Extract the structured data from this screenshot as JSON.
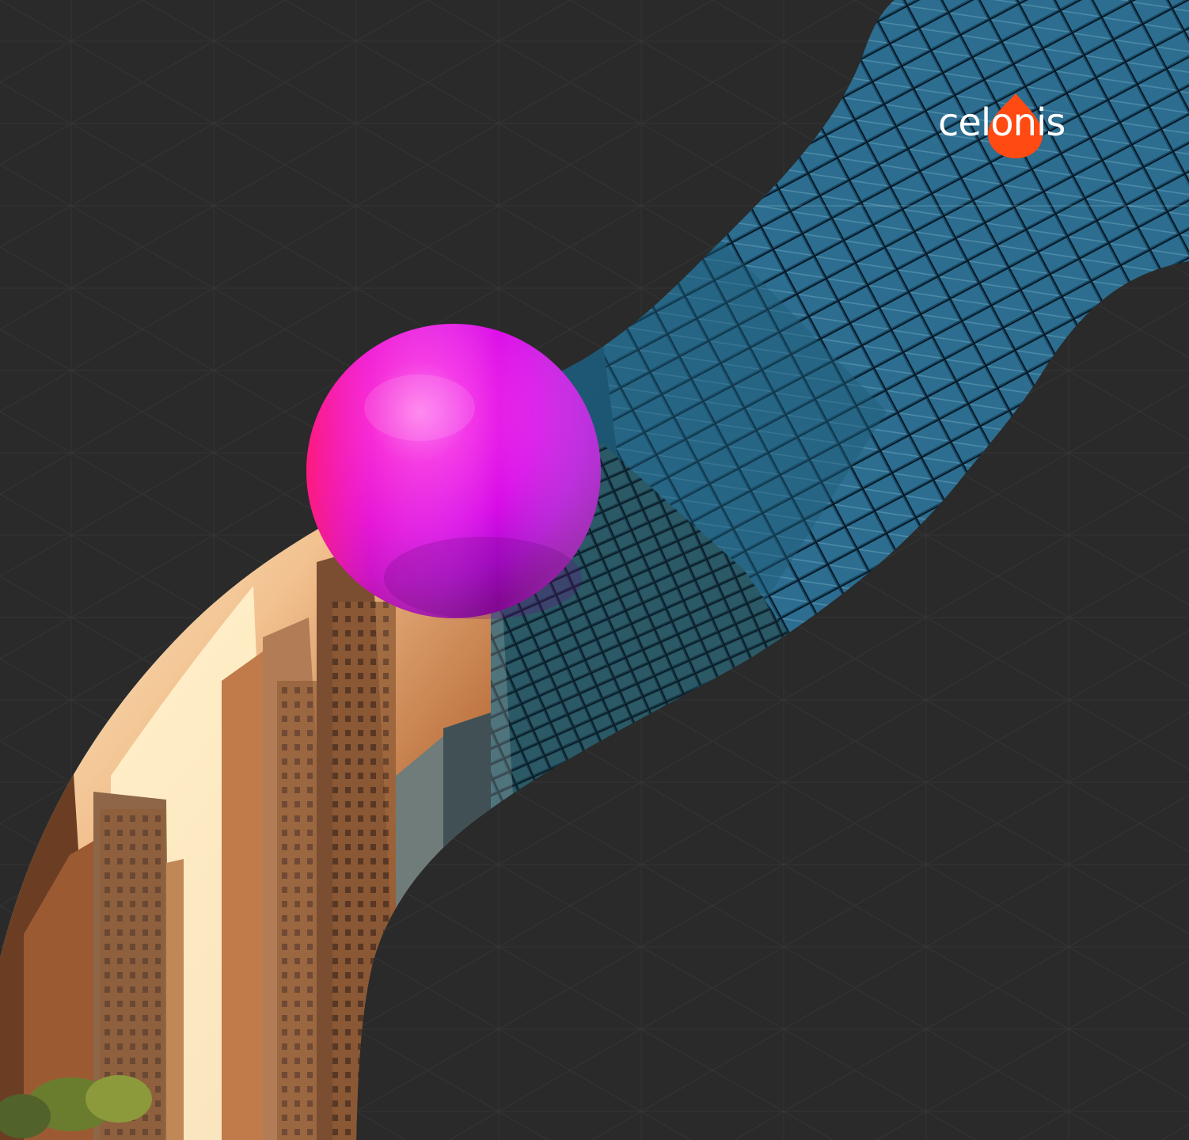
{
  "brand": {
    "wordmark": "celonis",
    "wordmark_color": "#ffffff",
    "mark_color": "#ff4a12"
  },
  "colors": {
    "background": "#2a2a2a",
    "grid_line": "#333333",
    "sphere_primary": "#e011e8",
    "sphere_highlight": "#ff63f3",
    "sphere_shadow": "#9a0bb0",
    "sphere_edge": "#ff1e78"
  },
  "scene": {
    "background_icon": "triangle-grid-pattern",
    "image_icon": "city-skyscrapers-photo",
    "sphere_icon": "magenta-sphere"
  }
}
